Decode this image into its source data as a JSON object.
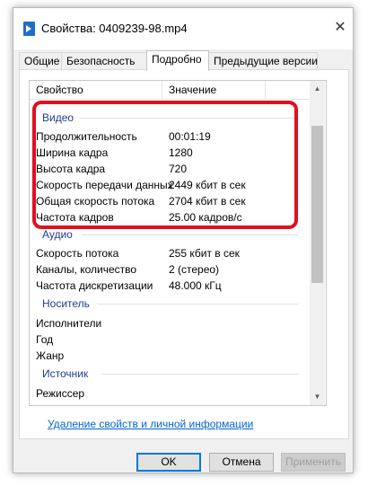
{
  "window": {
    "title": "Свойства: 0409239-98.mp4",
    "close_symbol": "✕"
  },
  "tabs": [
    {
      "label": "Общие"
    },
    {
      "label": "Безопасность"
    },
    {
      "label": "Подробно",
      "active": true
    },
    {
      "label": "Предыдущие версии"
    }
  ],
  "list": {
    "header": {
      "property": "Свойство",
      "value": "Значение"
    },
    "video": {
      "title": "Видео",
      "rows": [
        {
          "name": "Продолжительность",
          "value": "00:01:19"
        },
        {
          "name": "Ширина кадра",
          "value": "1280"
        },
        {
          "name": "Высота кадра",
          "value": "720"
        },
        {
          "name": "Скорость передачи данных",
          "value": "2449 кбит в сек"
        },
        {
          "name": "Общая скорость потока",
          "value": "2704 кбит в сек"
        },
        {
          "name": "Частота кадров",
          "value": "25.00 кадров/с"
        }
      ]
    },
    "audio": {
      "title": "Аудио",
      "rows": [
        {
          "name": "Скорость потока",
          "value": "255 кбит в сек"
        },
        {
          "name": "Каналы, количество",
          "value": "2 (стерео)"
        },
        {
          "name": "Частота дискретизации",
          "value": "48.000 кГц"
        }
      ]
    },
    "media": {
      "title": "Носитель",
      "rows": [
        {
          "name": "Исполнители",
          "value": ""
        },
        {
          "name": "Год",
          "value": ""
        },
        {
          "name": "Жанр",
          "value": ""
        }
      ]
    },
    "source": {
      "title": "Источник",
      "rows": [
        {
          "name": "Режиссер",
          "value": ""
        }
      ]
    }
  },
  "remove_link": "Удаление свойств и личной информации",
  "buttons": {
    "ok": "OK",
    "cancel": "Отмена",
    "apply": "Применить"
  },
  "colors": {
    "highlight": "#e0101f",
    "group_title": "#1e3d8f",
    "link": "#0066cc",
    "default_button_border": "#0078d7"
  }
}
